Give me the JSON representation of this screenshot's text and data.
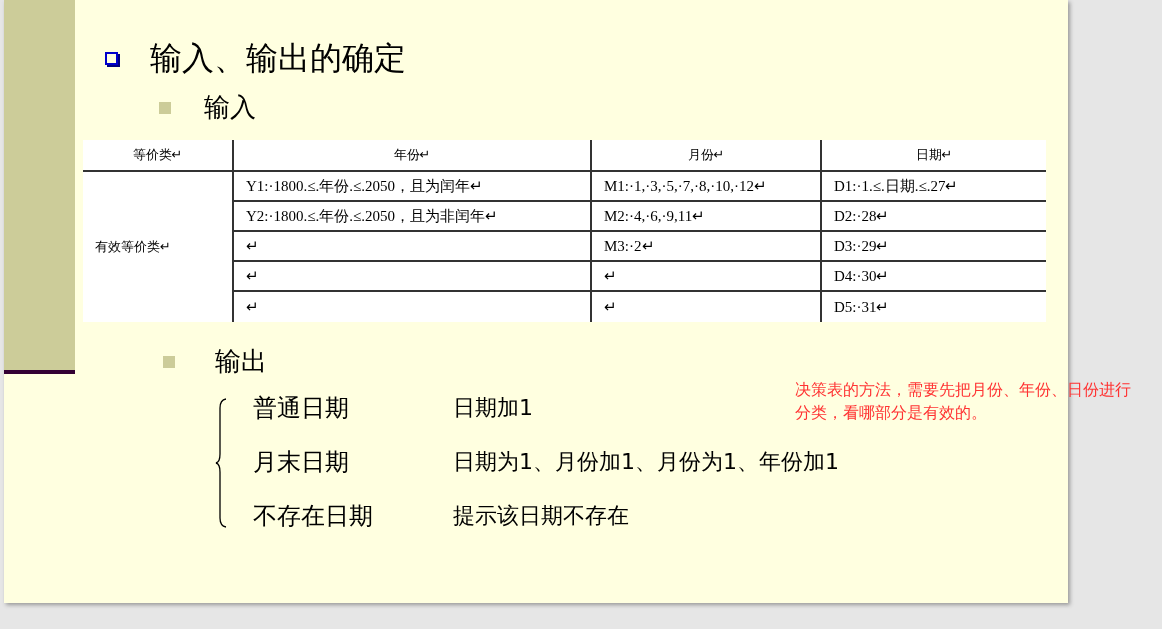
{
  "heading": "输入、输出的确定",
  "input": {
    "label": "输入"
  },
  "table": {
    "columns": [
      "等价类↵",
      "年份↵",
      "月份↵",
      "日期↵"
    ],
    "group_label": "有效等价类↵",
    "rows": [
      [
        "Y1:·1800.≤.年份.≤.2050，且为闰年↵",
        "M1:·1,·3,·5,·7,·8,·10,·12↵",
        "D1:·1.≤.日期.≤.27↵"
      ],
      [
        "Y2:·1800.≤.年份.≤.2050，且为非闰年↵",
        "M2:·4,·6,·9,11↵",
        "D2:·28↵"
      ],
      [
        "↵",
        "M3:·2↵",
        "D3:·29↵"
      ],
      [
        "↵",
        "↵",
        "D4:·30↵"
      ],
      [
        "↵",
        "↵",
        "D5:·31↵"
      ]
    ]
  },
  "output": {
    "label": "输出",
    "cases": [
      {
        "name": "普通日期",
        "result": "日期加1"
      },
      {
        "name": "月末日期",
        "result": "日期为1、月份加1、月份为1、年份加1"
      },
      {
        "name": "不存在日期",
        "result": "提示该日期不存在"
      }
    ]
  },
  "comment": "决策表的方法，需要先把月份、年份、日份进行分类，看哪部分是有效的。"
}
